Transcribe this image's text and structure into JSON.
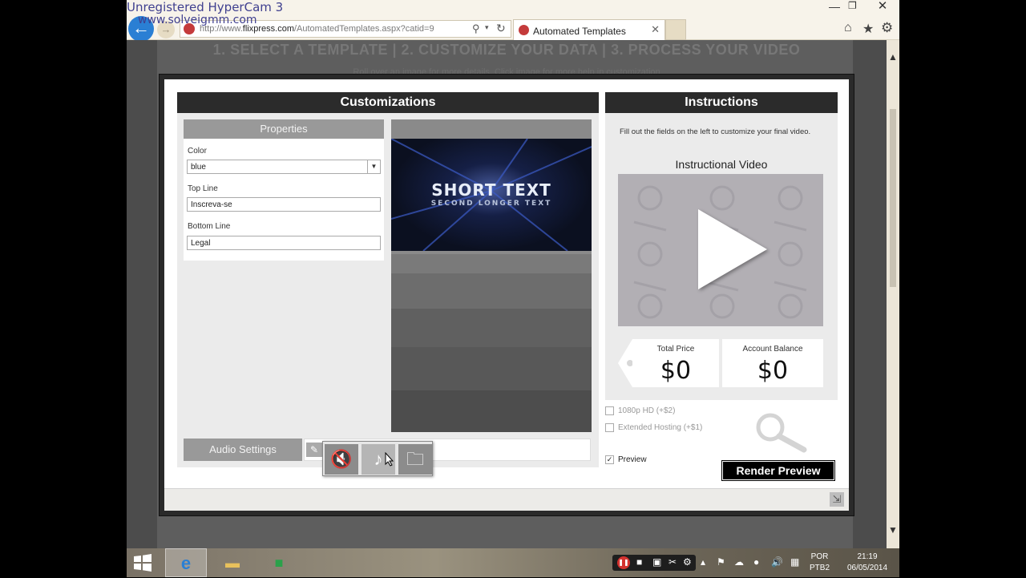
{
  "recorder": {
    "watermark_line1": "Unregistered HyperCam 3",
    "watermark_line2": "www.solveigmm.com"
  },
  "browser": {
    "address_prefix": "http://www.",
    "address_domain": "flixpress.com",
    "address_suffix": "/AutomatedTemplates.aspx?catid=9",
    "tab_title": "Automated Templates",
    "tab_close": "✕",
    "back_glyph": "←",
    "forward_glyph": "→",
    "min_glyph": "—",
    "max_glyph": "❐",
    "close_glyph": "✕",
    "home_glyph": "⌂",
    "star_glyph": "★",
    "gear_glyph": "⚙"
  },
  "page": {
    "steps": "1. SELECT A TEMPLATE | 2. CUSTOMIZE YOUR DATA | 3. PROCESS YOUR VIDEO",
    "steps_sub": "Roll over an image for more details. Click image for more help in customization"
  },
  "customizations": {
    "header": "Customizations",
    "properties_header": "Properties",
    "color_label": "Color",
    "color_value": "blue",
    "top_line_label": "Top Line",
    "top_line_value": "Inscreva-se",
    "bottom_line_label": "Bottom Line",
    "bottom_line_value": "Legal",
    "audio_settings_label": "Audio Settings",
    "preview_title": "SHORT TEXT",
    "preview_subtitle": "SECOND LONGER TEXT"
  },
  "instructions": {
    "header": "Instructions",
    "text": "Fill out the fields on the left to customize your final video.",
    "video_title": "Instructional Video",
    "total_price_label": "Total Price",
    "total_price_value": "$0",
    "account_balance_label": "Account Balance",
    "account_balance_value": "$0"
  },
  "options": {
    "hd_label": "1080p HD (+$2)",
    "hd_checked": false,
    "hosting_label": "Extended Hosting (+$1)",
    "hosting_checked": false,
    "preview_label": "Preview",
    "preview_checked": true,
    "preview_mark": "✓",
    "render_button": "Render Preview"
  },
  "taskbar": {
    "language_line1": "POR",
    "language_line2": "PTB2",
    "time": "21:19",
    "date": "06/05/2014"
  },
  "colors": {
    "header_dark": "#2b2b2b",
    "panel_gray": "#999999",
    "ie_blue": "#2a7fd4"
  }
}
